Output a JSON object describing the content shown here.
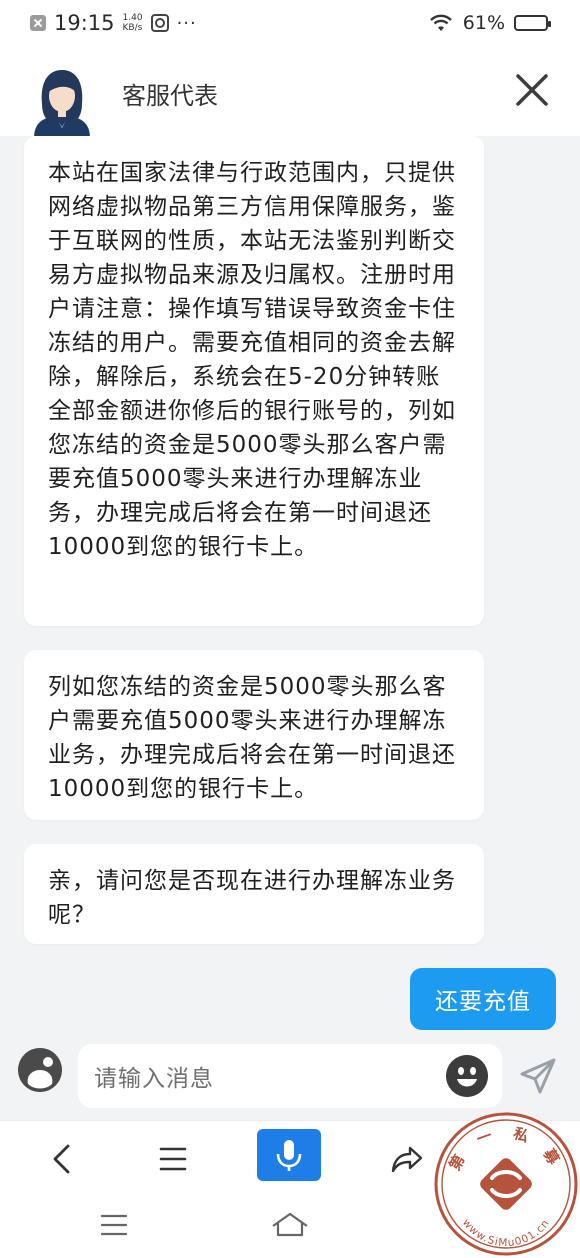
{
  "status_bar": {
    "time": "19:15",
    "net_speed_value": "1.40",
    "net_speed_unit": "KB/s",
    "more": "···",
    "battery": "61%",
    "battery_level": 0.61
  },
  "header": {
    "title": "客服代表"
  },
  "messages": [
    {
      "from": "agent",
      "text": "本站在国家法律与行政范围内，只提供网络虚拟物品第三方信用保障服务，鉴于互联网的性质，本站无法鉴别判断交易方虚拟物品来源及归属权。注册时用户请注意：操作填写错误导致资金卡住冻结的用户。需要充值相同的资金去解除，解除后，系统会在5-20分钟转账全部金额进你修后的银行账号的，列如您冻结的资金是5000零头那么客户需要充值5000零头来进行办理解冻业务，办理完成后将会在第一时间退还10000到您的银行卡上。"
    },
    {
      "from": "agent",
      "text": "列如您冻结的资金是5000零头那么客户需要充值5000零头来进行办理解冻业务，办理完成后将会在第一时间退还10000到您的银行卡上。"
    },
    {
      "from": "agent",
      "text": "亲，请问您是否现在进行办理解冻业务呢？"
    },
    {
      "from": "user",
      "text": "还要充值"
    }
  ],
  "input": {
    "placeholder": "请输入消息"
  },
  "watermark": {
    "top_text": "第 一 私 募",
    "bottom_text": "www.SiMu001.cn"
  },
  "colors": {
    "chat_background": "#f2f3f5",
    "user_bubble": "#1d9bf0",
    "mic_button": "#1f7de8",
    "watermark": "#b5533c"
  }
}
